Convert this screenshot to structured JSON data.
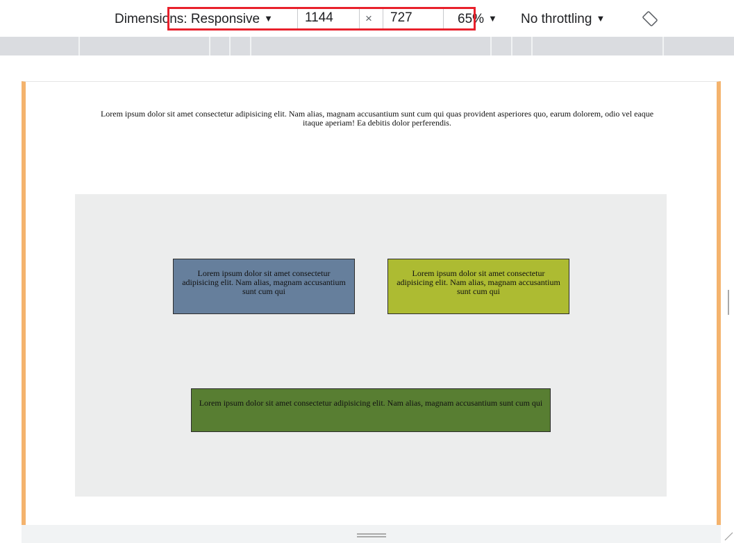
{
  "toolbar": {
    "dimensions_label": "Dimensions: Responsive",
    "width_value": "1144",
    "times": "×",
    "height_value": "727",
    "zoom": "65%",
    "throttling": "No throttling"
  },
  "page": {
    "intro": "Lorem ipsum dolor sit amet consectetur adipisicing elit. Nam alias, magnam accusantium sunt cum qui quas provident asperiores quo, earum dolorem, odio vel eaque itaque aperiam! Ea debitis dolor perferendis.",
    "card_blue": "Lorem ipsum dolor sit amet consectetur adipisicing elit. Nam alias, magnam accusantium sunt cum qui",
    "card_lime": "Lorem ipsum dolor sit amet consectetur adipisicing elit. Nam alias, magnam accusantium sunt cum qui",
    "card_green": "Lorem ipsum dolor sit amet consectetur adipisicing elit. Nam alias, magnam accusantium sunt cum qui"
  },
  "colors": {
    "highlight": "#e8202b",
    "frame_edge": "#f4b36d",
    "card_blue": "#667f9c",
    "card_lime": "#adbb32",
    "card_green": "#587e32"
  }
}
